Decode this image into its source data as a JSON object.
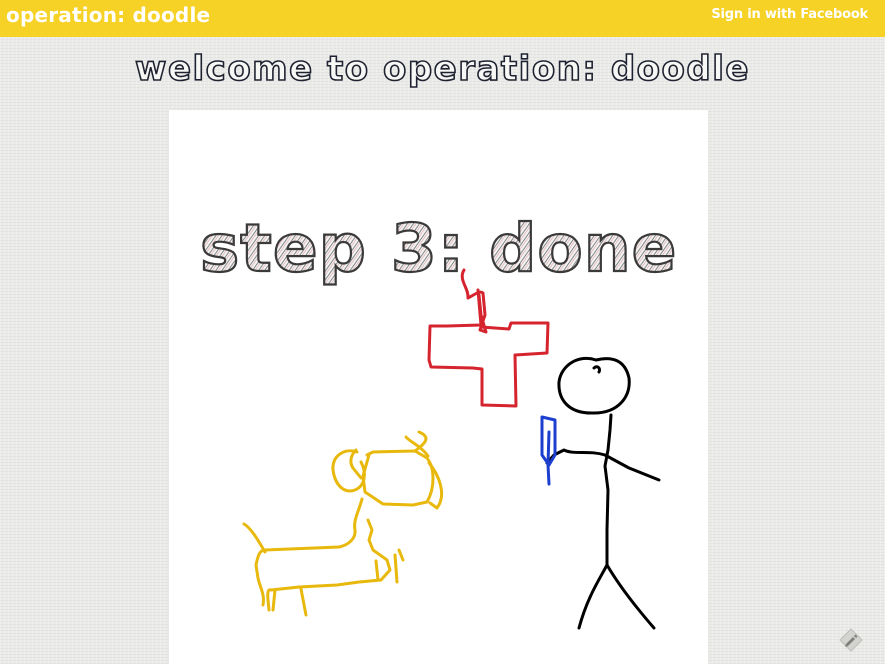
{
  "header": {
    "brand": "operation: doodle",
    "signin_label": "Sign in with Facebook"
  },
  "page": {
    "welcome_heading": "welcome to operation: doodle"
  },
  "canvas": {
    "title_text": "step 3: done",
    "drawings": [
      "stick-figure",
      "dog",
      "red-cross",
      "blue-knife"
    ]
  },
  "colors": {
    "header_bg": "#f6d126",
    "page_bg": "#ebebea",
    "heading_outline": "#1f2230",
    "stroke_black": "#000000",
    "stroke_red": "#d6242f",
    "stroke_yellow": "#e8b90c",
    "stroke_blue": "#1d3fd0"
  },
  "icons": {
    "corner_button": "pen-icon"
  }
}
